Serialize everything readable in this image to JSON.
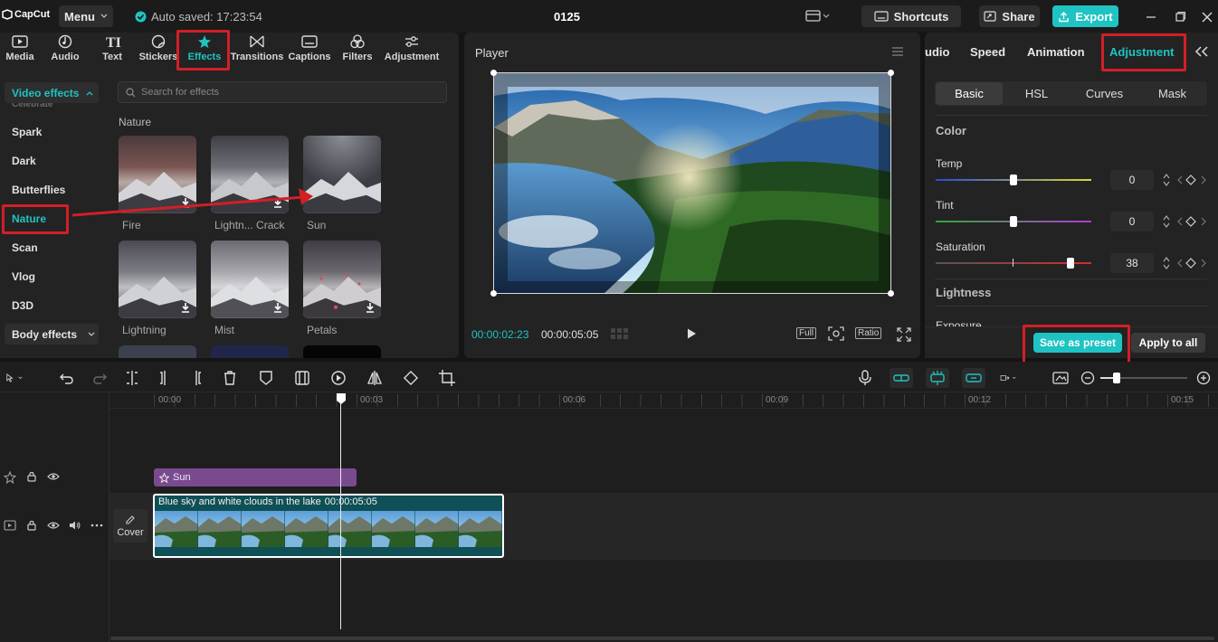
{
  "titlebar": {
    "logo": "CapCut",
    "menu_label": "Menu",
    "autosave": "Auto saved: 17:23:54",
    "project_name": "0125",
    "shortcuts_label": "Shortcuts",
    "share_label": "Share",
    "export_label": "Export"
  },
  "toolbar": {
    "items": [
      "Media",
      "Audio",
      "Text",
      "Stickers",
      "Effects",
      "Transitions",
      "Captions",
      "Filters",
      "Adjustment"
    ],
    "active": "Effects"
  },
  "effects_panel": {
    "category_header": "Video effects",
    "partial_item": "Celebrate",
    "categories": [
      "Spark",
      "Dark",
      "Butterflies",
      "Nature",
      "Scan",
      "Vlog",
      "D3D"
    ],
    "selected_category": "Nature",
    "body_effects_label": "Body effects",
    "search_placeholder": "Search for effects",
    "section_title": "Nature",
    "effects": [
      "Fire",
      "Lightn... Crack",
      "Sun",
      "Lightning",
      "Mist",
      "Petals"
    ]
  },
  "player": {
    "title": "Player",
    "current_time": "00:00:02:23",
    "total_time": "00:00:05:05",
    "full_label": "Full",
    "ratio_label": "Ratio"
  },
  "inspector": {
    "tabs": [
      "udio",
      "Speed",
      "Animation",
      "Adjustment"
    ],
    "active_tab": "Adjustment",
    "subtabs": [
      "Basic",
      "HSL",
      "Curves",
      "Mask"
    ],
    "active_subtab": "Basic",
    "color_section": "Color",
    "temp_label": "Temp",
    "temp_value": "0",
    "tint_label": "Tint",
    "tint_value": "0",
    "saturation_label": "Saturation",
    "saturation_value": "38",
    "lightness_section": "Lightness",
    "exposure_partial": "Exposure",
    "save_preset_label": "Save as preset",
    "apply_all_label": "Apply to all"
  },
  "timeline": {
    "ruler": [
      "00:00",
      "00:03",
      "00:06",
      "00:09",
      "00:12",
      "00:15"
    ],
    "effect_clip_label": "Sun",
    "video_clip_title": "Blue sky and white clouds in the lake",
    "video_clip_duration": "00:00:05:05",
    "cover_label": "Cover"
  },
  "colors": {
    "accent": "#1fc3c3",
    "highlight_red": "#d21f26",
    "effect_clip": "#7a4a8f",
    "video_clip": "#0f4f56"
  }
}
